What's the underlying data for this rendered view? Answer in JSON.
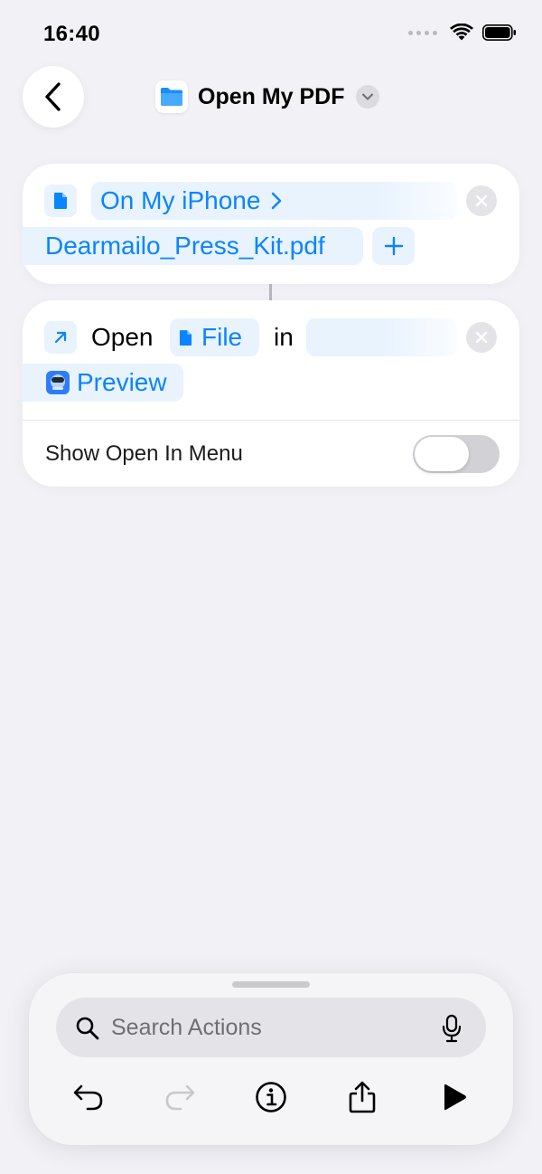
{
  "status": {
    "time": "16:40"
  },
  "header": {
    "title": "Open My PDF"
  },
  "action1": {
    "location": "On My iPhone",
    "file_name": "Dearmailo_Press_Kit.pdf",
    "add_label": "+"
  },
  "action2": {
    "verb": "Open",
    "param": "File",
    "connector": "in",
    "app": "Preview",
    "toggle_label": "Show Open In Menu",
    "toggle_on": false
  },
  "bottom": {
    "search_placeholder": "Search Actions"
  },
  "colors": {
    "accent": "#0a84ff",
    "background": "#f1f1f6",
    "pill": "#e8f3fe"
  }
}
